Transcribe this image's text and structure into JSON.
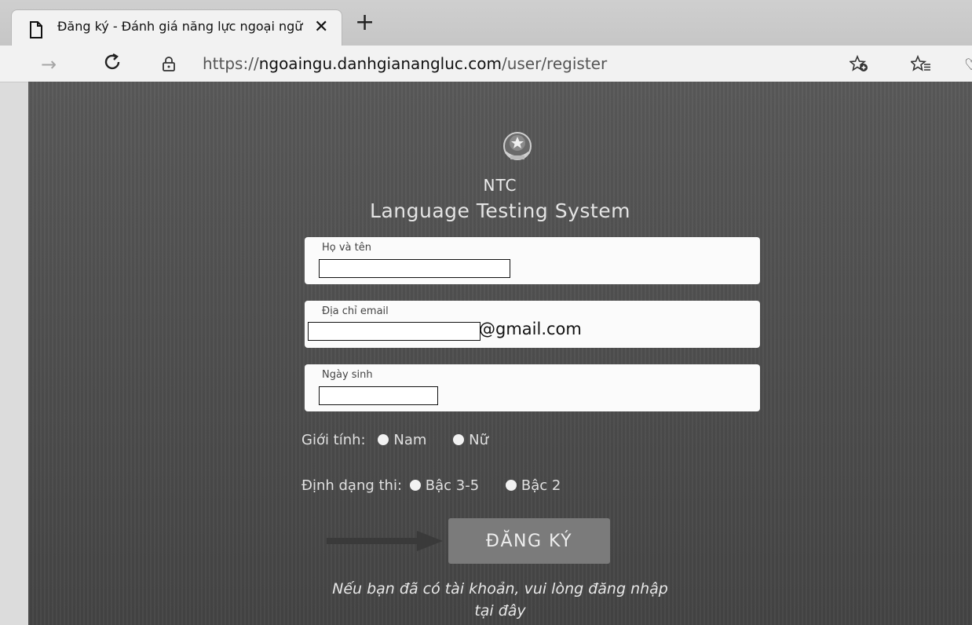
{
  "browser": {
    "tab_title": "Đăng ký - Đánh giá năng lực ngoại ngữ",
    "new_tab_symbol": "+",
    "close_symbol": "✕",
    "url_prefix": "https://",
    "url_host": "ngoaingu.danhgianangluc.com",
    "url_path": "/user/register",
    "icons": [
      "page-icon",
      "forward-icon",
      "refresh-icon",
      "lock-icon",
      "favorite-add-icon",
      "favorites-icon"
    ]
  },
  "brand": {
    "line1": "NTC",
    "line2": "Language Testing System"
  },
  "form": {
    "name_label": "Họ và tên",
    "name_value": "",
    "email_label": "Địa chỉ email",
    "email_suffix": "@gmail.com",
    "dob_label": "Ngày sinh",
    "dob_value": "",
    "gender_label": "Giới tính:",
    "gender_options": [
      "Nam",
      "Nữ"
    ],
    "format_label": "Định dạng thi:",
    "format_options": [
      "Bậc 3-5",
      "Bậc 2"
    ],
    "submit_label": "ĐĂNG KÝ",
    "login_note_line1": "Nếu bạn đã có tài khoản, vui lòng đăng nhập",
    "login_note_line2": "tại đây"
  },
  "colors": {
    "page_bg": "#4f4f4f",
    "button_bg": "#7b7b7b",
    "field_bg": "#fbfbfb"
  }
}
